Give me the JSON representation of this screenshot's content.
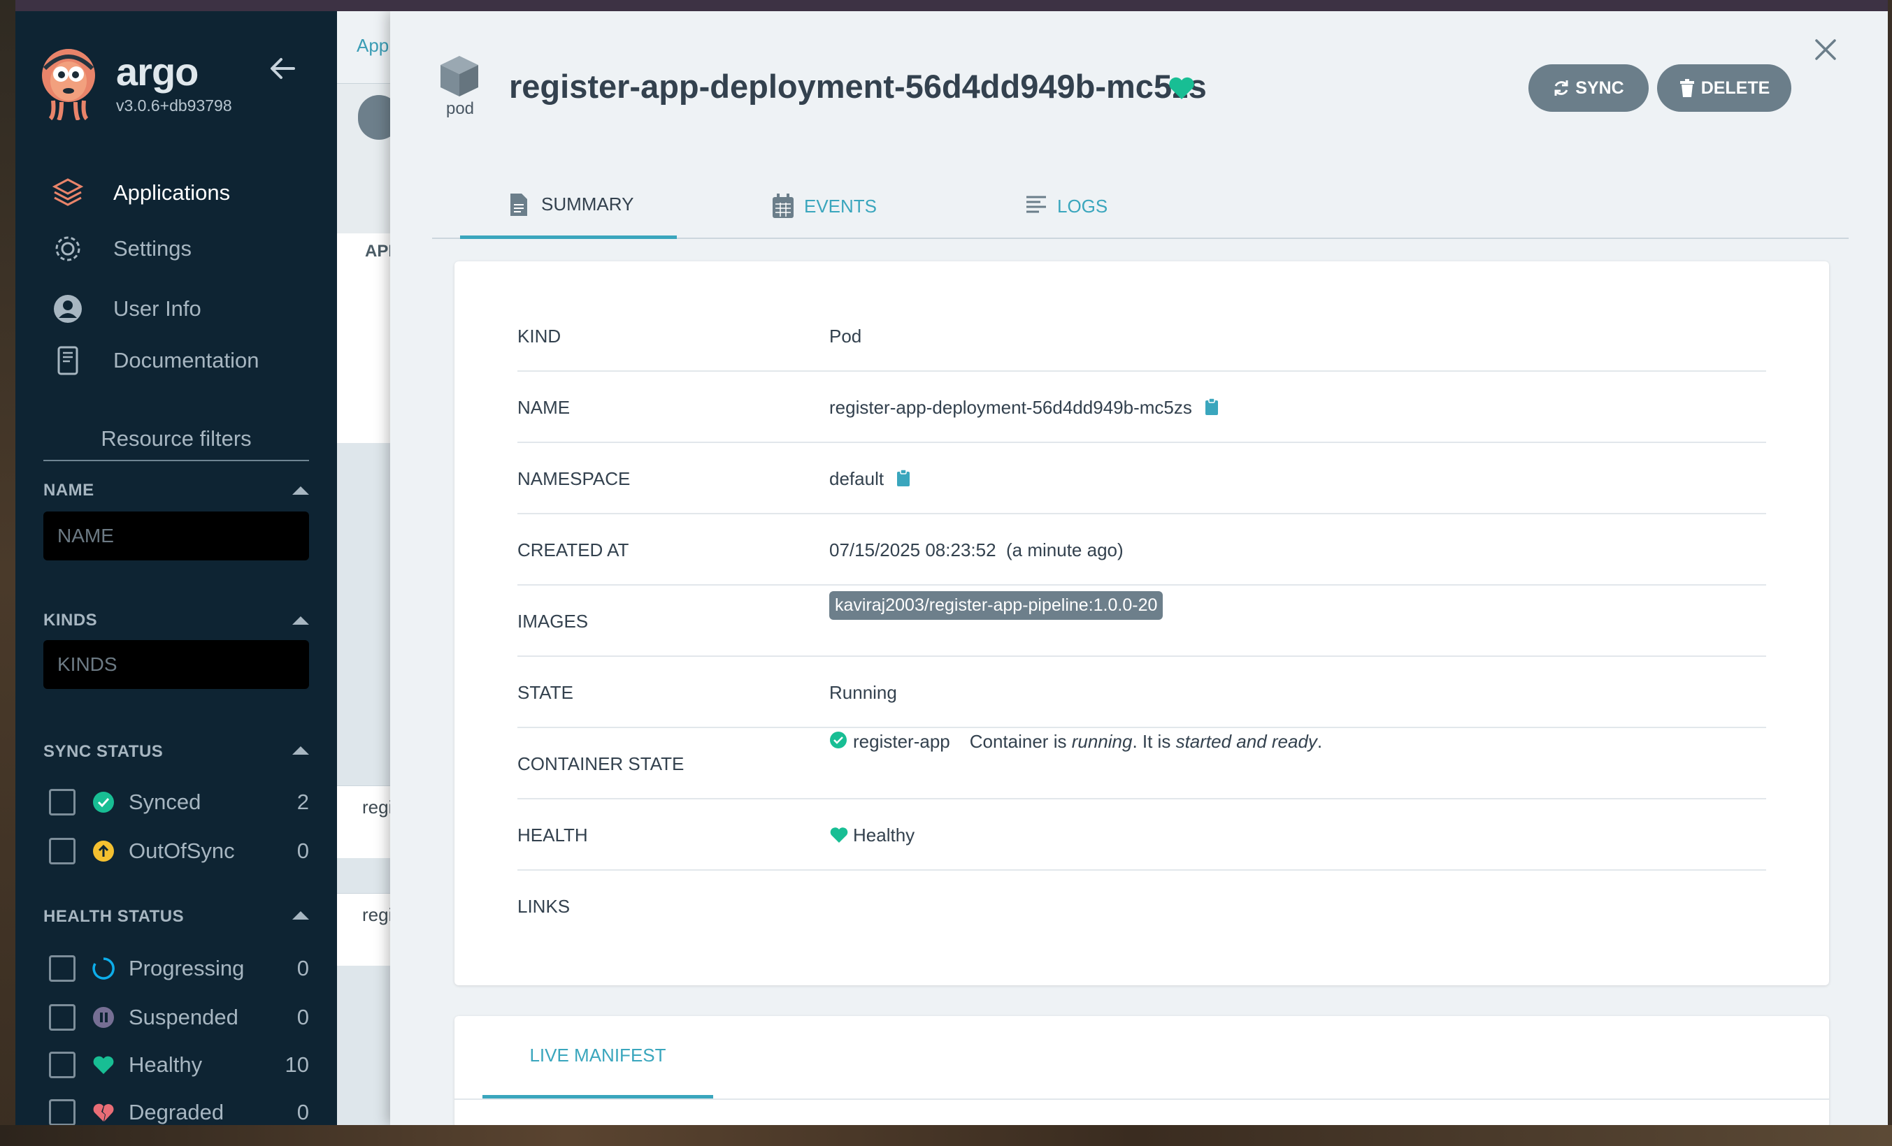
{
  "sidebar": {
    "brand": "argo",
    "version": "v3.0.6+db93798",
    "nav": [
      {
        "label": "Applications",
        "icon": "layers-icon"
      },
      {
        "label": "Settings",
        "icon": "gear-icon"
      },
      {
        "label": "User Info",
        "icon": "user-circle-icon"
      },
      {
        "label": "Documentation",
        "icon": "book-icon"
      }
    ],
    "filters": {
      "title": "Resource filters",
      "name": {
        "title": "NAME",
        "placeholder": "NAME"
      },
      "kinds": {
        "title": "KINDS",
        "placeholder": "KINDS"
      },
      "sync_status": {
        "title": "SYNC STATUS",
        "items": [
          {
            "label": "Synced",
            "count": "2"
          },
          {
            "label": "OutOfSync",
            "count": "0"
          }
        ]
      },
      "health_status": {
        "title": "HEALTH STATUS",
        "items": [
          {
            "label": "Progressing",
            "count": "0"
          },
          {
            "label": "Suspended",
            "count": "0"
          },
          {
            "label": "Healthy",
            "count": "10"
          },
          {
            "label": "Degraded",
            "count": "0"
          }
        ]
      }
    }
  },
  "background": {
    "breadcrumb": "App",
    "apps_label": "API",
    "row1": "regi",
    "row2": "regi"
  },
  "panel": {
    "kind_icon_label": "pod",
    "title": "register-app-deployment-56d4dd949b-mc5zs",
    "sync_label": "SYNC",
    "delete_label": "DELETE",
    "tabs": [
      {
        "label": "SUMMARY"
      },
      {
        "label": "EVENTS"
      },
      {
        "label": "LOGS"
      }
    ],
    "summary": {
      "kind": {
        "key": "KIND",
        "value": "Pod"
      },
      "name": {
        "key": "NAME",
        "value": "register-app-deployment-56d4dd949b-mc5zs"
      },
      "namespace": {
        "key": "NAMESPACE",
        "value": "default"
      },
      "created": {
        "key": "CREATED AT",
        "value": "07/15/2025 08:23:52  (a minute ago)"
      },
      "images": {
        "key": "IMAGES",
        "value": "kaviraj2003/register-app-pipeline:1.0.0-20"
      },
      "state": {
        "key": "STATE",
        "value": "Running"
      },
      "container_state": {
        "key": "CONTAINER STATE",
        "container": "register-app",
        "text1": "Container is ",
        "em1": "running",
        "text2": ". It is ",
        "em2": "started and ready",
        "text3": "."
      },
      "health": {
        "key": "HEALTH",
        "value": "Healthy"
      },
      "links": {
        "key": "LINKS",
        "value": ""
      }
    },
    "manifest_tab": "LIVE MANIFEST"
  },
  "colors": {
    "sidebar_bg": "#0e2433",
    "accent": "#3aa6bd",
    "healthy": "#18be94",
    "button": "#6b7e8a"
  }
}
